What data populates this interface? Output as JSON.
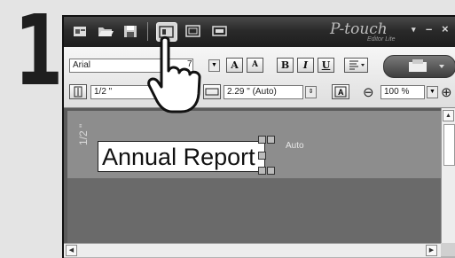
{
  "step": {
    "number": "1"
  },
  "app": {
    "logo_text": "P-touch",
    "logo_sub": "Editor Lite"
  },
  "toolbar": {
    "icons": [
      "wizard-icon",
      "open-folder-icon",
      "save-icon",
      "layout-view-icon",
      "frame-view-icon",
      "print-preview-icon"
    ],
    "minimize": "–",
    "close": "×",
    "expand": "▾"
  },
  "ribbon": {
    "font_family": "Arial",
    "font_size": "7",
    "btn_grow": "A",
    "btn_shrink": "A",
    "btn_bold": "B",
    "btn_italic": "I",
    "btn_underline": "U",
    "tape_width": "1/2 \"",
    "tape_length": "2.29 \" (Auto)",
    "zoom": "100 %",
    "zoom_out": "⊖",
    "zoom_in": "⊕"
  },
  "canvas": {
    "label_text": "Annual Report",
    "size_marker": "1/2 \"",
    "auto_label": "Auto"
  },
  "colors": {
    "titlebar": "#2a2a2a",
    "canvas": "#5b5b5b",
    "tape": "#8d8d8d"
  }
}
